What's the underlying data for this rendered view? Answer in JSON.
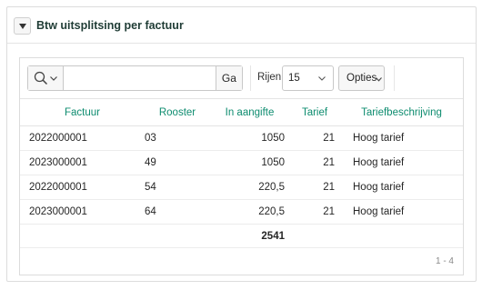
{
  "region": {
    "title": "Btw uitsplitsing per factuur"
  },
  "toolbar": {
    "search_placeholder": "",
    "search_value": "",
    "go_label": "Ga",
    "rows_label": "Rijen",
    "rows_value": "15",
    "actions_label": "Opties"
  },
  "table": {
    "headers": [
      "Factuur",
      "Rooster",
      "In aangifte",
      "Tarief",
      "Tariefbeschrijving"
    ],
    "rows": [
      {
        "factuur": "2022000001",
        "rooster": "03",
        "aangifte": "1050",
        "tarief": "21",
        "beschrijving": "Hoog tarief"
      },
      {
        "factuur": "2023000001",
        "rooster": "49",
        "aangifte": "1050",
        "tarief": "21",
        "beschrijving": "Hoog tarief"
      },
      {
        "factuur": "2022000001",
        "rooster": "54",
        "aangifte": "220,5",
        "tarief": "21",
        "beschrijving": "Hoog tarief"
      },
      {
        "factuur": "2023000001",
        "rooster": "64",
        "aangifte": "220,5",
        "tarief": "21",
        "beschrijving": "Hoog tarief"
      }
    ],
    "total": "2541"
  },
  "pagination": "1 - 4",
  "colors": {
    "accent": "#0d8c6f",
    "title": "#1f3c35",
    "border": "#dcdcdc"
  },
  "icons": {
    "collapse": "triangle-down-icon",
    "search": "search-icon",
    "chevron": "chevron-down-icon"
  }
}
